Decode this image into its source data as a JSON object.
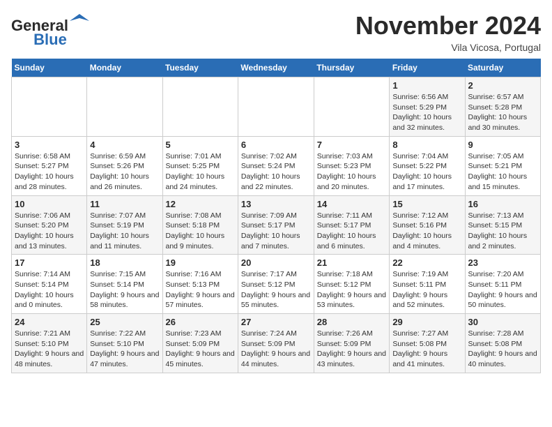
{
  "logo": {
    "name_part1": "General",
    "name_part2": "Blue"
  },
  "title": "November 2024",
  "subtitle": "Vila Vicosa, Portugal",
  "days_of_week": [
    "Sunday",
    "Monday",
    "Tuesday",
    "Wednesday",
    "Thursday",
    "Friday",
    "Saturday"
  ],
  "weeks": [
    [
      {
        "day": "",
        "info": ""
      },
      {
        "day": "",
        "info": ""
      },
      {
        "day": "",
        "info": ""
      },
      {
        "day": "",
        "info": ""
      },
      {
        "day": "",
        "info": ""
      },
      {
        "day": "1",
        "info": "Sunrise: 6:56 AM\nSunset: 5:29 PM\nDaylight: 10 hours and 32 minutes."
      },
      {
        "day": "2",
        "info": "Sunrise: 6:57 AM\nSunset: 5:28 PM\nDaylight: 10 hours and 30 minutes."
      }
    ],
    [
      {
        "day": "3",
        "info": "Sunrise: 6:58 AM\nSunset: 5:27 PM\nDaylight: 10 hours and 28 minutes."
      },
      {
        "day": "4",
        "info": "Sunrise: 6:59 AM\nSunset: 5:26 PM\nDaylight: 10 hours and 26 minutes."
      },
      {
        "day": "5",
        "info": "Sunrise: 7:01 AM\nSunset: 5:25 PM\nDaylight: 10 hours and 24 minutes."
      },
      {
        "day": "6",
        "info": "Sunrise: 7:02 AM\nSunset: 5:24 PM\nDaylight: 10 hours and 22 minutes."
      },
      {
        "day": "7",
        "info": "Sunrise: 7:03 AM\nSunset: 5:23 PM\nDaylight: 10 hours and 20 minutes."
      },
      {
        "day": "8",
        "info": "Sunrise: 7:04 AM\nSunset: 5:22 PM\nDaylight: 10 hours and 17 minutes."
      },
      {
        "day": "9",
        "info": "Sunrise: 7:05 AM\nSunset: 5:21 PM\nDaylight: 10 hours and 15 minutes."
      }
    ],
    [
      {
        "day": "10",
        "info": "Sunrise: 7:06 AM\nSunset: 5:20 PM\nDaylight: 10 hours and 13 minutes."
      },
      {
        "day": "11",
        "info": "Sunrise: 7:07 AM\nSunset: 5:19 PM\nDaylight: 10 hours and 11 minutes."
      },
      {
        "day": "12",
        "info": "Sunrise: 7:08 AM\nSunset: 5:18 PM\nDaylight: 10 hours and 9 minutes."
      },
      {
        "day": "13",
        "info": "Sunrise: 7:09 AM\nSunset: 5:17 PM\nDaylight: 10 hours and 7 minutes."
      },
      {
        "day": "14",
        "info": "Sunrise: 7:11 AM\nSunset: 5:17 PM\nDaylight: 10 hours and 6 minutes."
      },
      {
        "day": "15",
        "info": "Sunrise: 7:12 AM\nSunset: 5:16 PM\nDaylight: 10 hours and 4 minutes."
      },
      {
        "day": "16",
        "info": "Sunrise: 7:13 AM\nSunset: 5:15 PM\nDaylight: 10 hours and 2 minutes."
      }
    ],
    [
      {
        "day": "17",
        "info": "Sunrise: 7:14 AM\nSunset: 5:14 PM\nDaylight: 10 hours and 0 minutes."
      },
      {
        "day": "18",
        "info": "Sunrise: 7:15 AM\nSunset: 5:14 PM\nDaylight: 9 hours and 58 minutes."
      },
      {
        "day": "19",
        "info": "Sunrise: 7:16 AM\nSunset: 5:13 PM\nDaylight: 9 hours and 57 minutes."
      },
      {
        "day": "20",
        "info": "Sunrise: 7:17 AM\nSunset: 5:12 PM\nDaylight: 9 hours and 55 minutes."
      },
      {
        "day": "21",
        "info": "Sunrise: 7:18 AM\nSunset: 5:12 PM\nDaylight: 9 hours and 53 minutes."
      },
      {
        "day": "22",
        "info": "Sunrise: 7:19 AM\nSunset: 5:11 PM\nDaylight: 9 hours and 52 minutes."
      },
      {
        "day": "23",
        "info": "Sunrise: 7:20 AM\nSunset: 5:11 PM\nDaylight: 9 hours and 50 minutes."
      }
    ],
    [
      {
        "day": "24",
        "info": "Sunrise: 7:21 AM\nSunset: 5:10 PM\nDaylight: 9 hours and 48 minutes."
      },
      {
        "day": "25",
        "info": "Sunrise: 7:22 AM\nSunset: 5:10 PM\nDaylight: 9 hours and 47 minutes."
      },
      {
        "day": "26",
        "info": "Sunrise: 7:23 AM\nSunset: 5:09 PM\nDaylight: 9 hours and 45 minutes."
      },
      {
        "day": "27",
        "info": "Sunrise: 7:24 AM\nSunset: 5:09 PM\nDaylight: 9 hours and 44 minutes."
      },
      {
        "day": "28",
        "info": "Sunrise: 7:26 AM\nSunset: 5:09 PM\nDaylight: 9 hours and 43 minutes."
      },
      {
        "day": "29",
        "info": "Sunrise: 7:27 AM\nSunset: 5:08 PM\nDaylight: 9 hours and 41 minutes."
      },
      {
        "day": "30",
        "info": "Sunrise: 7:28 AM\nSunset: 5:08 PM\nDaylight: 9 hours and 40 minutes."
      }
    ]
  ]
}
